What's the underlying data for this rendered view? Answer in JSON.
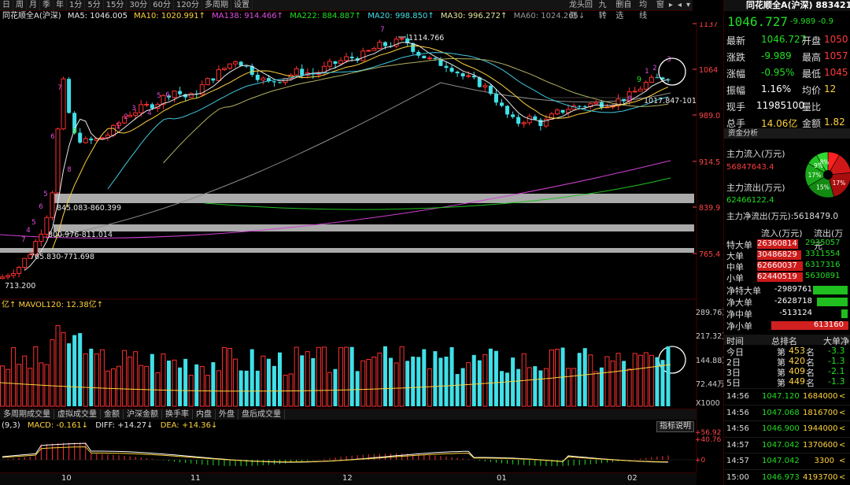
{
  "toolbar": {
    "periods": [
      "日",
      "周",
      "月",
      "季",
      "年",
      "1分",
      "5分",
      "15分",
      "30分",
      "60分",
      "120分",
      "多周期",
      "设置"
    ],
    "right_buttons": [
      "龙头回测",
      "九转",
      "删自选",
      "均线",
      "窗"
    ]
  },
  "ma_legend": {
    "name": "同花顺全A(沪深)",
    "ma5": "MA5: 1046.005",
    "ma10": "MA10: 1020.991↑",
    "ma138": "MA138: 914.466↑",
    "ma222": "MA222: 884.887↑",
    "ma20": "MA20: 998.850↑",
    "ma30": "MA30: 996.272↑",
    "ma60": "MA60: 1024.265↓"
  },
  "price_axis": [
    "1137",
    "1064",
    "989.0",
    "914.5",
    "839.9",
    "765.4"
  ],
  "annotations": {
    "high": "1114.766",
    "low": "713.200",
    "zone1": "845.083-860.399",
    "zone2": "800.976-811.014",
    "zone3": "765.830-771.698",
    "right_level": "1017.847-101"
  },
  "nine_count": [
    "5",
    "6",
    "7",
    "8",
    "9",
    "1",
    "2",
    "3",
    "4",
    "5",
    "6",
    "7",
    "8",
    "9",
    "1",
    "2",
    "3",
    "4",
    "5",
    "6",
    "7"
  ],
  "volume": {
    "legend": "亿↑ MAVOL120: 12.38亿↑",
    "axis": [
      "289.76万",
      "217.32万",
      "144.88万",
      "72.44万",
      "X1000"
    ]
  },
  "indicator_tabs": [
    "多周期成交量",
    "虚拟成交量",
    "金额",
    "沪深金额",
    "换手率",
    "内盘",
    "外盘",
    "盘后成交量"
  ],
  "macd": {
    "params": "(9,3)",
    "macd": "MACD: -0.161↓",
    "diff": "DIFF: +14.27↓",
    "dea": "DEA: +14.36↓",
    "axis": [
      "+56.92",
      "+40.76",
      "+0"
    ],
    "button": "指标说明"
  },
  "dates": [
    "10",
    "11",
    "12",
    "01",
    "02"
  ],
  "quote": {
    "title": "同花顺全A(沪深) 883421",
    "price": "1046.727",
    "change": "-9.989  -0.9",
    "rows": [
      {
        "k": "最新",
        "v": "1046.727",
        "k2": "开盘",
        "v2": "1050"
      },
      {
        "k": "涨跌",
        "v": "-9.989",
        "k2": "最高",
        "v2": "1057"
      },
      {
        "k": "涨幅",
        "v": "-0.95%",
        "k2": "最低",
        "v2": "1045"
      },
      {
        "k": "振幅",
        "v": "1.16%",
        "k2": "均价",
        "v2": "12"
      },
      {
        "k": "现手",
        "v": "11985100",
        "k2": "量比",
        "v2": ""
      },
      {
        "k": "总手",
        "v": "14.06亿",
        "k2": "金额",
        "v2": "1.82"
      }
    ]
  },
  "capital": {
    "header": "资金分析",
    "inflow_label": "主力流入(万元)",
    "inflow_value": "56847643.4",
    "outflow_label": "主力流出(万元)",
    "outflow_value": "62466122.4",
    "net_label": "主力净流出(万元):5618479.0",
    "pie": [
      "9%",
      "8%",
      "17%",
      "15%",
      "17%"
    ]
  },
  "flow_table": {
    "head_in": "流入(万元)",
    "head_out": "流出(万元",
    "rows": [
      {
        "name": "特大单",
        "in": "26360814",
        "out": "2935057"
      },
      {
        "name": "大单",
        "in": "30486829",
        "out": "3311554"
      },
      {
        "name": "中单",
        "in": "62660037",
        "out": "6317316"
      },
      {
        "name": "小单",
        "in": "62440519",
        "out": "5630891"
      }
    ]
  },
  "net_rows": [
    {
      "name": "净特大单",
      "v": "-2989761"
    },
    {
      "name": "净大单",
      "v": "-2628718"
    },
    {
      "name": "净中单",
      "v": "-513124"
    },
    {
      "name": "净小单",
      "v": "613160"
    }
  ],
  "rank": {
    "head": [
      "时间",
      "总排名",
      "大单净"
    ],
    "rows": [
      {
        "t": "今日",
        "p": "第",
        "r": "453",
        "u": "名",
        "v": "-3.3"
      },
      {
        "t": "2日",
        "p": "第",
        "r": "420",
        "u": "名",
        "v": "-1.3"
      },
      {
        "t": "3日",
        "p": "第",
        "r": "409",
        "u": "名",
        "v": "-2.1"
      },
      {
        "t": "5日",
        "p": "第",
        "r": "449",
        "u": "名",
        "v": "-1.3"
      }
    ]
  },
  "ticks": [
    {
      "t": "14:56",
      "p": "1047.120",
      "v": "1684000"
    },
    {
      "t": "14:56",
      "p": "1047.068",
      "v": "1816700"
    },
    {
      "t": "14:56",
      "p": "1046.900",
      "v": "1944000"
    },
    {
      "t": "14:57",
      "p": "1047.042",
      "v": "1370600"
    },
    {
      "t": "14:57",
      "p": "1047.042",
      "v": "3300"
    },
    {
      "t": "15:00",
      "p": "1046.973",
      "v": "4193700"
    }
  ]
}
